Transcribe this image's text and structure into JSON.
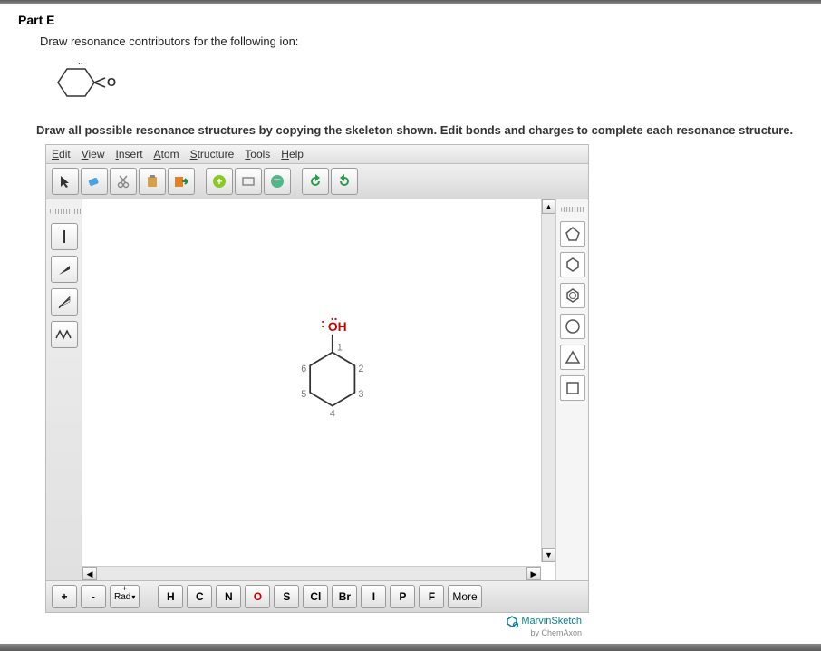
{
  "part_title": "Part E",
  "instruction1": "Draw resonance contributors for the following ion:",
  "instruction2": "Draw all possible resonance structures by copying the skeleton shown. Edit bonds and charges to complete each resonance structure.",
  "menu": {
    "edit": "Edit",
    "view": "View",
    "insert": "Insert",
    "atom": "Atom",
    "structure": "Structure",
    "tools": "Tools",
    "help": "Help"
  },
  "toolbar_icons": [
    "cursor",
    "eraser",
    "cut",
    "paste",
    "export",
    "zoom-in",
    "zoom-fit",
    "zoom-out",
    "undo",
    "redo"
  ],
  "left_icons": [
    "single-bond",
    "wedge-bond",
    "hash-bond",
    "chain"
  ],
  "right_shapes": [
    "pentagon",
    "hexagon",
    "benzene",
    "cycloheptane",
    "triangle",
    "square"
  ],
  "bottom": {
    "plus": "+",
    "minus": "-",
    "rad": "Rad",
    "elements": [
      "H",
      "C",
      "N",
      "O",
      "S",
      "Cl",
      "Br",
      "I",
      "P",
      "F"
    ],
    "more": "More"
  },
  "molecule": {
    "label": "OH",
    "nums": [
      "1",
      "2",
      "3",
      "4",
      "5",
      "6"
    ]
  },
  "branding": {
    "name": "MarvinSketch",
    "by": "by ChemAxon"
  }
}
